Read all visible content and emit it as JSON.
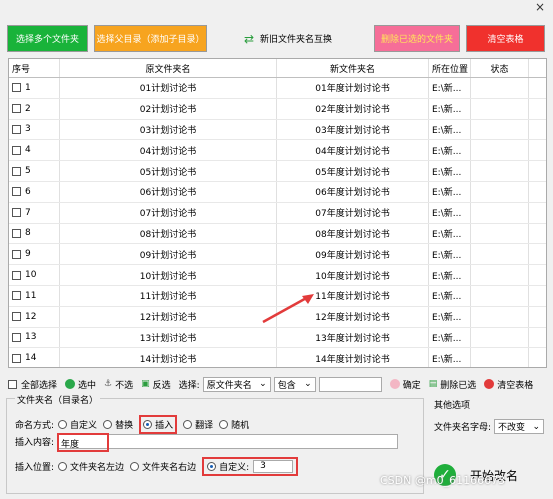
{
  "top_buttons": {
    "add_multi": "选择多个文件夹",
    "add_parent": "选择父目录（添加子目录）",
    "swap": "新旧文件夹名互换",
    "delete_selected": "删除已选的文件夹",
    "clear_table": "清空表格"
  },
  "table": {
    "headers": [
      "序号",
      "原文件夹名",
      "新文件夹名",
      "所在位置",
      "状态"
    ],
    "rows": [
      {
        "no": "1",
        "orig": "01计划讨论书",
        "new": "01年度计划讨论书",
        "loc": "E:\\新..."
      },
      {
        "no": "2",
        "orig": "02计划讨论书",
        "new": "02年度计划讨论书",
        "loc": "E:\\新..."
      },
      {
        "no": "3",
        "orig": "03计划讨论书",
        "new": "03年度计划讨论书",
        "loc": "E:\\新..."
      },
      {
        "no": "4",
        "orig": "04计划讨论书",
        "new": "04年度计划讨论书",
        "loc": "E:\\新..."
      },
      {
        "no": "5",
        "orig": "05计划讨论书",
        "new": "05年度计划讨论书",
        "loc": "E:\\新..."
      },
      {
        "no": "6",
        "orig": "06计划讨论书",
        "new": "06年度计划讨论书",
        "loc": "E:\\新..."
      },
      {
        "no": "7",
        "orig": "07计划讨论书",
        "new": "07年度计划讨论书",
        "loc": "E:\\新..."
      },
      {
        "no": "8",
        "orig": "08计划讨论书",
        "new": "08年度计划讨论书",
        "loc": "E:\\新..."
      },
      {
        "no": "9",
        "orig": "09计划讨论书",
        "new": "09年度计划讨论书",
        "loc": "E:\\新..."
      },
      {
        "no": "10",
        "orig": "10计划讨论书",
        "new": "10年度计划讨论书",
        "loc": "E:\\新..."
      },
      {
        "no": "11",
        "orig": "11计划讨论书",
        "new": "11年度计划讨论书",
        "loc": "E:\\新..."
      },
      {
        "no": "12",
        "orig": "12计划讨论书",
        "new": "12年度计划讨论书",
        "loc": "E:\\新..."
      },
      {
        "no": "13",
        "orig": "13计划讨论书",
        "new": "13年度计划讨论书",
        "loc": "E:\\新..."
      },
      {
        "no": "14",
        "orig": "14计划讨论书",
        "new": "14年度计划讨论书",
        "loc": "E:\\新..."
      }
    ]
  },
  "toolbar": {
    "select_all": "全部选择",
    "check": "选中",
    "uncheck": "不选",
    "invert": "反选",
    "select_label": "选择:",
    "field_value": "原文件夹名",
    "match_value": "包含",
    "confirm": "确定",
    "delete_selected": "删除已选",
    "clear_table": "清空表格"
  },
  "options": {
    "group_title": "文件夹名（目录名）",
    "mode_label": "命名方式:",
    "modes": [
      "自定义",
      "替换",
      "插入",
      "翻译",
      "随机"
    ],
    "selected_mode": "插入",
    "insert_label": "插入内容:",
    "insert_value": "年度",
    "position_label": "插入位置:",
    "positions": [
      "文件夹名左边",
      "文件夹名右边",
      "自定义:"
    ],
    "selected_position": "自定义:",
    "custom_value": "3"
  },
  "other": {
    "title": "其他选项",
    "case_label": "文件夹名字母:",
    "case_value": "不改变"
  },
  "start_button": "开始改名",
  "watermark": "CSDN @m0_61166673"
}
